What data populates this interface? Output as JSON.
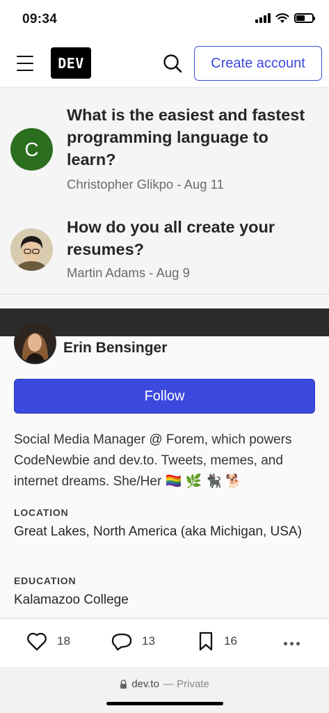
{
  "status_bar": {
    "time": "09:34"
  },
  "header": {
    "logo": "DEV",
    "create_account": "Create account"
  },
  "articles": [
    {
      "avatar_letter": "C",
      "avatar_color": "#2c6e1f",
      "title": "What is the easiest and fastest programming language to learn?",
      "meta": "Christopher Glikpo - Aug 11"
    },
    {
      "title": "How do you all create your resumes?",
      "meta": "Martin Adams - Aug 9"
    }
  ],
  "profile": {
    "name": "Erin Bensinger",
    "follow_label": "Follow",
    "bio": "Social Media Manager @ Forem, which powers CodeNewbie and dev.to. Tweets, memes, and internet dreams. She/Her 🏳️‍🌈 🌿 🐈‍⬛ 🐕",
    "location_label": "LOCATION",
    "location": "Great Lakes, North America (aka Michigan, USA)",
    "education_label": "EDUCATION",
    "education": "Kalamazoo College"
  },
  "actions": {
    "likes": "18",
    "comments": "13",
    "bookmarks": "16"
  },
  "browser": {
    "domain": "dev.to",
    "privacy": "— Private"
  },
  "colors": {
    "accent": "#3b49df",
    "dark_strip": "#2b2b2b"
  }
}
